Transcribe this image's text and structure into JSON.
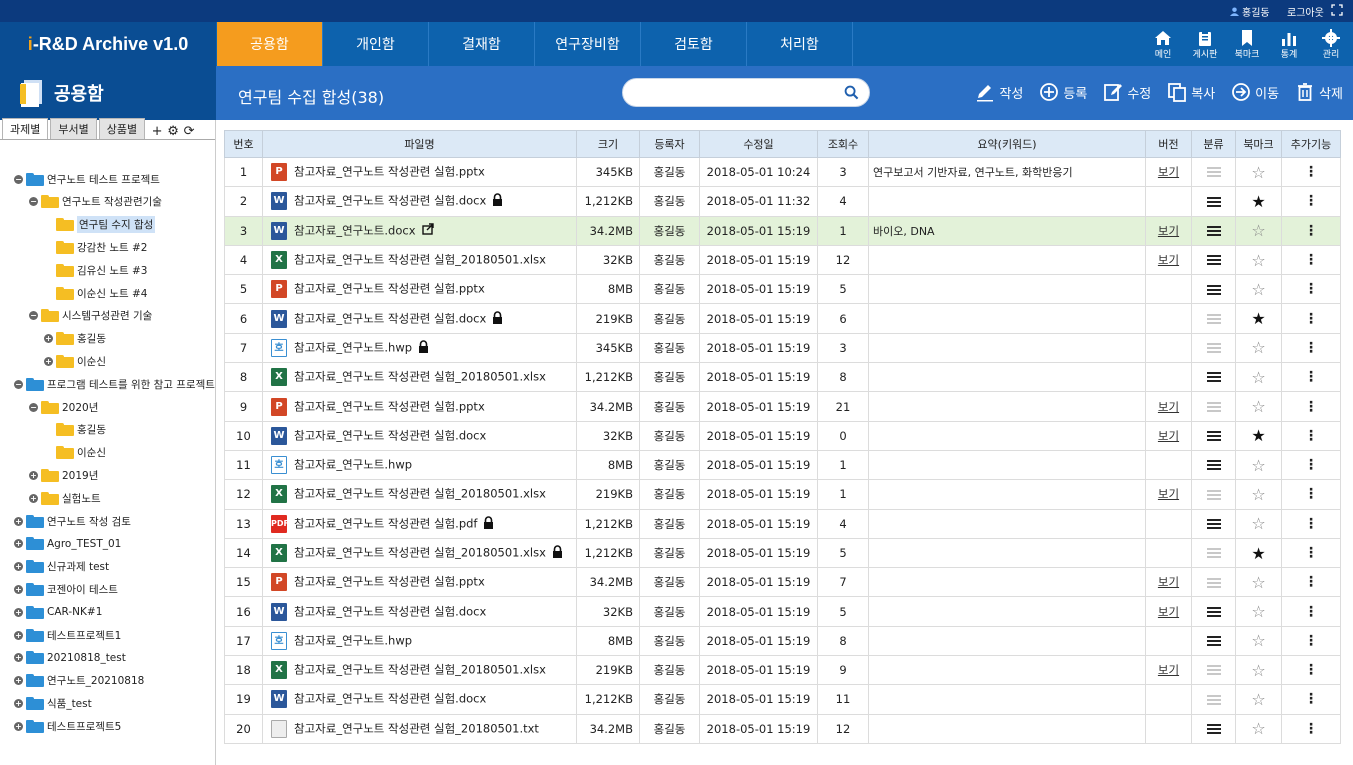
{
  "top": {
    "user": "홍길동",
    "logout": "로그아웃"
  },
  "logo": {
    "prefix": "i",
    "text": "-R&D Archive v1.0"
  },
  "tabs": [
    "공용함",
    "개인함",
    "결재함",
    "연구장비함",
    "검토함",
    "처리함"
  ],
  "quick": [
    {
      "label": "메인",
      "icon": "home-icon"
    },
    {
      "label": "게시판",
      "icon": "clipboard-icon"
    },
    {
      "label": "북마크",
      "icon": "bookmark-icon"
    },
    {
      "label": "통계",
      "icon": "bar-chart-icon"
    },
    {
      "label": "관리",
      "icon": "gear-icon"
    }
  ],
  "sidebar": {
    "title": "공용함",
    "subtabs": [
      "과제별",
      "부서별",
      "상품별"
    ]
  },
  "main": {
    "title": "연구팀 수집 합성(38)",
    "search_placeholder": ""
  },
  "actions": [
    {
      "label": "작성",
      "icon": "pen-icon"
    },
    {
      "label": "등록",
      "icon": "plus-circle-icon"
    },
    {
      "label": "수정",
      "icon": "edit-icon"
    },
    {
      "label": "복사",
      "icon": "copy-icon"
    },
    {
      "label": "이동",
      "icon": "arrow-circle-icon"
    },
    {
      "label": "삭제",
      "icon": "trash-icon"
    }
  ],
  "tree": [
    {
      "label": "연구노트 테스트 프로젝트",
      "level": 0,
      "toggle": "−",
      "color": "#2d8fd6"
    },
    {
      "label": "연구노트 작성관련기술",
      "level": 1,
      "toggle": "−",
      "color": "#f5be23"
    },
    {
      "label": "연구팀 수지 합성",
      "level": 2,
      "toggle": "",
      "color": "#f5be23",
      "selected": true
    },
    {
      "label": "강감찬 노트 #2",
      "level": 2,
      "toggle": "",
      "color": "#f5be23"
    },
    {
      "label": "김유신 노트 #3",
      "level": 2,
      "toggle": "",
      "color": "#f5be23"
    },
    {
      "label": "이순신 노트 #4",
      "level": 2,
      "toggle": "",
      "color": "#f5be23"
    },
    {
      "label": "시스템구성관련 기술",
      "level": 1,
      "toggle": "−",
      "color": "#f5be23"
    },
    {
      "label": "홍길동",
      "level": 2,
      "toggle": "+",
      "color": "#f5be23"
    },
    {
      "label": "이순신",
      "level": 2,
      "toggle": "+",
      "color": "#f5be23"
    },
    {
      "label": "프로그램 테스트를 위한 참고 프로젝트",
      "level": 0,
      "toggle": "−",
      "color": "#2d8fd6"
    },
    {
      "label": "2020년",
      "level": 1,
      "toggle": "−",
      "color": "#f5be23"
    },
    {
      "label": "홍길동",
      "level": 2,
      "toggle": "",
      "color": "#f5be23"
    },
    {
      "label": "이순신",
      "level": 2,
      "toggle": "",
      "color": "#f5be23"
    },
    {
      "label": "2019년",
      "level": 1,
      "toggle": "+",
      "color": "#f5be23"
    },
    {
      "label": "실험노트",
      "level": 1,
      "toggle": "+",
      "color": "#f5be23"
    },
    {
      "label": "연구노트 작성 검토",
      "level": 0,
      "toggle": "+",
      "color": "#2d8fd6"
    },
    {
      "label": "Agro_TEST_01",
      "level": 0,
      "toggle": "+",
      "color": "#2d8fd6"
    },
    {
      "label": "신규과제 test",
      "level": 0,
      "toggle": "+",
      "color": "#2d8fd6"
    },
    {
      "label": "코젠아이 테스트",
      "level": 0,
      "toggle": "+",
      "color": "#2d8fd6"
    },
    {
      "label": "CAR-NK#1",
      "level": 0,
      "toggle": "+",
      "color": "#2d8fd6"
    },
    {
      "label": "테스트프로젝트1",
      "level": 0,
      "toggle": "+",
      "color": "#2d8fd6"
    },
    {
      "label": "20210818_test",
      "level": 0,
      "toggle": "+",
      "color": "#2d8fd6"
    },
    {
      "label": "연구노트_20210818",
      "level": 0,
      "toggle": "+",
      "color": "#2d8fd6"
    },
    {
      "label": "식품_test",
      "level": 0,
      "toggle": "+",
      "color": "#2d8fd6"
    },
    {
      "label": "테스트프로젝트5",
      "level": 0,
      "toggle": "+",
      "color": "#2d8fd6"
    }
  ],
  "table": {
    "headers": [
      "번호",
      "파일명",
      "크기",
      "등록자",
      "수정일",
      "조회수",
      "요약(키워드)",
      "버전",
      "분류",
      "북마크",
      "추가기능"
    ],
    "rows": [
      {
        "no": "1",
        "type": "pptx",
        "name": "참고자료_연구노트 작성관련 실험.pptx",
        "lock": false,
        "share": false,
        "size": "345KB",
        "user": "홍길동",
        "date": "2018-05-01 10:24",
        "views": "3",
        "summary": "연구보고서 기반자료, 연구노트, 화학반응기",
        "ver": "보기",
        "cls": "dim",
        "bm": false
      },
      {
        "no": "2",
        "type": "docx",
        "name": "참고자료_연구노트 작성관련 실험.docx",
        "lock": true,
        "share": false,
        "size": "1,212KB",
        "user": "홍길동",
        "date": "2018-05-01 11:32",
        "views": "4",
        "summary": "",
        "ver": "",
        "cls": "on",
        "bm": true
      },
      {
        "no": "3",
        "type": "docx",
        "name": "참고자료_연구노트.docx",
        "lock": false,
        "share": true,
        "size": "34.2MB",
        "user": "홍길동",
        "date": "2018-05-01 15:19",
        "views": "1",
        "summary": "바이오, DNA",
        "ver": "보기",
        "cls": "on",
        "bm": false,
        "hl": true
      },
      {
        "no": "4",
        "type": "xlsx",
        "name": "참고자료_연구노트 작성관련 실험_20180501.xlsx",
        "lock": false,
        "share": false,
        "size": "32KB",
        "user": "홍길동",
        "date": "2018-05-01 15:19",
        "views": "12",
        "summary": "",
        "ver": "보기",
        "cls": "on",
        "bm": false
      },
      {
        "no": "5",
        "type": "pptx",
        "name": "참고자료_연구노트 작성관련 실험.pptx",
        "lock": false,
        "share": false,
        "size": "8MB",
        "user": "홍길동",
        "date": "2018-05-01 15:19",
        "views": "5",
        "summary": "",
        "ver": "",
        "cls": "on",
        "bm": false
      },
      {
        "no": "6",
        "type": "docx",
        "name": "참고자료_연구노트 작성관련 실험.docx",
        "lock": true,
        "share": false,
        "size": "219KB",
        "user": "홍길동",
        "date": "2018-05-01 15:19",
        "views": "6",
        "summary": "",
        "ver": "",
        "cls": "dim",
        "bm": true
      },
      {
        "no": "7",
        "type": "hwp",
        "name": "참고자료_연구노트.hwp",
        "lock": true,
        "share": false,
        "size": "345KB",
        "user": "홍길동",
        "date": "2018-05-01 15:19",
        "views": "3",
        "summary": "",
        "ver": "",
        "cls": "dim",
        "bm": false
      },
      {
        "no": "8",
        "type": "xlsx",
        "name": "참고자료_연구노트 작성관련 실험_20180501.xlsx",
        "lock": false,
        "share": false,
        "size": "1,212KB",
        "user": "홍길동",
        "date": "2018-05-01 15:19",
        "views": "8",
        "summary": "",
        "ver": "",
        "cls": "on",
        "bm": false
      },
      {
        "no": "9",
        "type": "pptx",
        "name": "참고자료_연구노트 작성관련 실험.pptx",
        "lock": false,
        "share": false,
        "size": "34.2MB",
        "user": "홍길동",
        "date": "2018-05-01 15:19",
        "views": "21",
        "summary": "",
        "ver": "보기",
        "cls": "dim",
        "bm": false
      },
      {
        "no": "10",
        "type": "docx",
        "name": "참고자료_연구노트 작성관련 실험.docx",
        "lock": false,
        "share": false,
        "size": "32KB",
        "user": "홍길동",
        "date": "2018-05-01 15:19",
        "views": "0",
        "summary": "",
        "ver": "보기",
        "cls": "on",
        "bm": true
      },
      {
        "no": "11",
        "type": "hwp",
        "name": "참고자료_연구노트.hwp",
        "lock": false,
        "share": false,
        "size": "8MB",
        "user": "홍길동",
        "date": "2018-05-01 15:19",
        "views": "1",
        "summary": "",
        "ver": "",
        "cls": "on",
        "bm": false
      },
      {
        "no": "12",
        "type": "xlsx",
        "name": "참고자료_연구노트 작성관련 실험_20180501.xlsx",
        "lock": false,
        "share": false,
        "size": "219KB",
        "user": "홍길동",
        "date": "2018-05-01 15:19",
        "views": "1",
        "summary": "",
        "ver": "보기",
        "cls": "dim",
        "bm": false
      },
      {
        "no": "13",
        "type": "pdf",
        "name": "참고자료_연구노트 작성관련 실험.pdf",
        "lock": true,
        "share": false,
        "size": "1,212KB",
        "user": "홍길동",
        "date": "2018-05-01 15:19",
        "views": "4",
        "summary": "",
        "ver": "",
        "cls": "on",
        "bm": false
      },
      {
        "no": "14",
        "type": "xlsx",
        "name": "참고자료_연구노트 작성관련 실험_20180501.xlsx",
        "lock": true,
        "share": false,
        "size": "1,212KB",
        "user": "홍길동",
        "date": "2018-05-01 15:19",
        "views": "5",
        "summary": "",
        "ver": "",
        "cls": "dim",
        "bm": true
      },
      {
        "no": "15",
        "type": "pptx",
        "name": "참고자료_연구노트 작성관련 실험.pptx",
        "lock": false,
        "share": false,
        "size": "34.2MB",
        "user": "홍길동",
        "date": "2018-05-01 15:19",
        "views": "7",
        "summary": "",
        "ver": "보기",
        "cls": "dim",
        "bm": false
      },
      {
        "no": "16",
        "type": "docx",
        "name": "참고자료_연구노트 작성관련 실험.docx",
        "lock": false,
        "share": false,
        "size": "32KB",
        "user": "홍길동",
        "date": "2018-05-01 15:19",
        "views": "5",
        "summary": "",
        "ver": "보기",
        "cls": "on",
        "bm": false
      },
      {
        "no": "17",
        "type": "hwp",
        "name": "참고자료_연구노트.hwp",
        "lock": false,
        "share": false,
        "size": "8MB",
        "user": "홍길동",
        "date": "2018-05-01 15:19",
        "views": "8",
        "summary": "",
        "ver": "",
        "cls": "on",
        "bm": false
      },
      {
        "no": "18",
        "type": "xlsx",
        "name": "참고자료_연구노트 작성관련 실험_20180501.xlsx",
        "lock": false,
        "share": false,
        "size": "219KB",
        "user": "홍길동",
        "date": "2018-05-01 15:19",
        "views": "9",
        "summary": "",
        "ver": "보기",
        "cls": "dim",
        "bm": false
      },
      {
        "no": "19",
        "type": "docx",
        "name": "참고자료_연구노트 작성관련 실험.docx",
        "lock": false,
        "share": false,
        "size": "1,212KB",
        "user": "홍길동",
        "date": "2018-05-01 15:19",
        "views": "11",
        "summary": "",
        "ver": "",
        "cls": "dim",
        "bm": false
      },
      {
        "no": "20",
        "type": "txt",
        "name": "참고자료_연구노트 작성관련 실험_20180501.txt",
        "lock": false,
        "share": false,
        "size": "34.2MB",
        "user": "홍길동",
        "date": "2018-05-01 15:19",
        "views": "12",
        "summary": "",
        "ver": "",
        "cls": "on",
        "bm": false
      }
    ]
  }
}
